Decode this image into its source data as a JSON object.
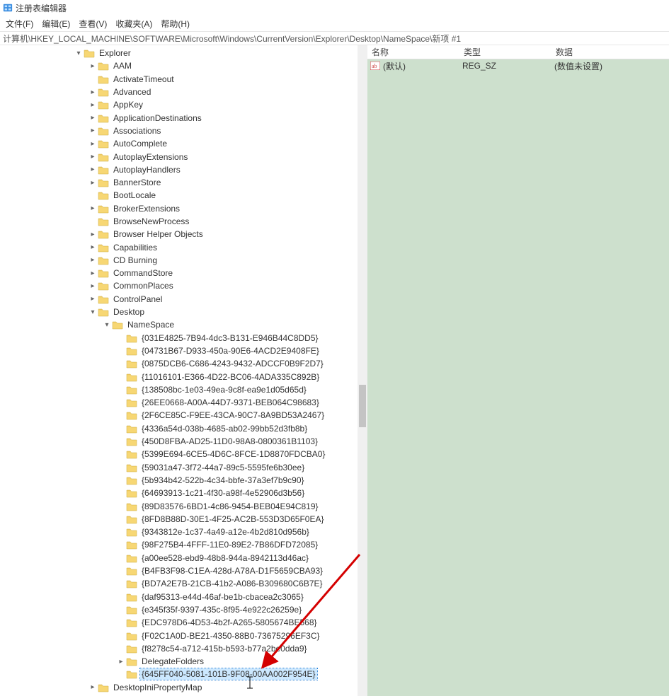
{
  "window": {
    "title": "注册表编辑器"
  },
  "menu": {
    "file": "文件(F)",
    "edit": "编辑(E)",
    "view": "查看(V)",
    "favorites": "收藏夹(A)",
    "help": "帮助(H)"
  },
  "address": {
    "path": "计算机\\HKEY_LOCAL_MACHINE\\SOFTWARE\\Microsoft\\Windows\\CurrentVersion\\Explorer\\Desktop\\NameSpace\\新项 #1"
  },
  "columns": {
    "name": "名称",
    "type": "类型",
    "data": "数据"
  },
  "valueRow": {
    "name": "(默认)",
    "type": "REG_SZ",
    "data": "(数值未设置)"
  },
  "tree": {
    "explorer": "Explorer",
    "children": {
      "aam": "AAM",
      "activateTimeout": "ActivateTimeout",
      "advanced": "Advanced",
      "appKey": "AppKey",
      "applicationDestinations": "ApplicationDestinations",
      "associations": "Associations",
      "autoComplete": "AutoComplete",
      "autoplayExtensions": "AutoplayExtensions",
      "autoplayHandlers": "AutoplayHandlers",
      "bannerStore": "BannerStore",
      "bootLocale": "BootLocale",
      "brokerExtensions": "BrokerExtensions",
      "browseNewProcess": "BrowseNewProcess",
      "browserHelperObjects": "Browser Helper Objects",
      "capabilities": "Capabilities",
      "cdBurning": "CD Burning",
      "commandStore": "CommandStore",
      "commonPlaces": "CommonPlaces",
      "controlPanel": "ControlPanel",
      "desktop": "Desktop",
      "nameSpace": "NameSpace",
      "ns": [
        "{031E4825-7B94-4dc3-B131-E946B44C8DD5}",
        "{04731B67-D933-450a-90E6-4ACD2E9408FE}",
        "{0875DCB6-C686-4243-9432-ADCCF0B9F2D7}",
        "{11016101-E366-4D22-BC06-4ADA335C892B}",
        "{138508bc-1e03-49ea-9c8f-ea9e1d05d65d}",
        "{26EE0668-A00A-44D7-9371-BEB064C98683}",
        "{2F6CE85C-F9EE-43CA-90C7-8A9BD53A2467}",
        "{4336a54d-038b-4685-ab02-99bb52d3fb8b}",
        "{450D8FBA-AD25-11D0-98A8-0800361B1103}",
        "{5399E694-6CE5-4D6C-8FCE-1D8870FDCBA0}",
        "{59031a47-3f72-44a7-89c5-5595fe6b30ee}",
        "{5b934b42-522b-4c34-bbfe-37a3ef7b9c90}",
        "{64693913-1c21-4f30-a98f-4e52906d3b56}",
        "{89D83576-6BD1-4c86-9454-BEB04E94C819}",
        "{8FD8B88D-30E1-4F25-AC2B-553D3D65F0EA}",
        "{9343812e-1c37-4a49-a12e-4b2d810d956b}",
        "{98F275B4-4FFF-11E0-89E2-7B86DFD72085}",
        "{a00ee528-ebd9-48b8-944a-8942113d46ac}",
        "{B4FB3F98-C1EA-428d-A78A-D1F5659CBA93}",
        "{BD7A2E7B-21CB-41b2-A086-B309680C6B7E}",
        "{daf95313-e44d-46af-be1b-cbacea2c3065}",
        "{e345f35f-9397-435c-8f95-4e922c26259e}",
        "{EDC978D6-4D53-4b2f-A265-5805674BE568}",
        "{F02C1A0D-BE21-4350-88B0-73675296EF3C}",
        "{f8278c54-a712-415b-b593-b77a2be0dda9}"
      ],
      "delegateFolders": "DelegateFolders",
      "selectedGuid": "{645FF040-5081-101B-9F08-00AA002F954E}",
      "desktopIniPropertyMap": "DesktopIniPropertyMap"
    }
  }
}
